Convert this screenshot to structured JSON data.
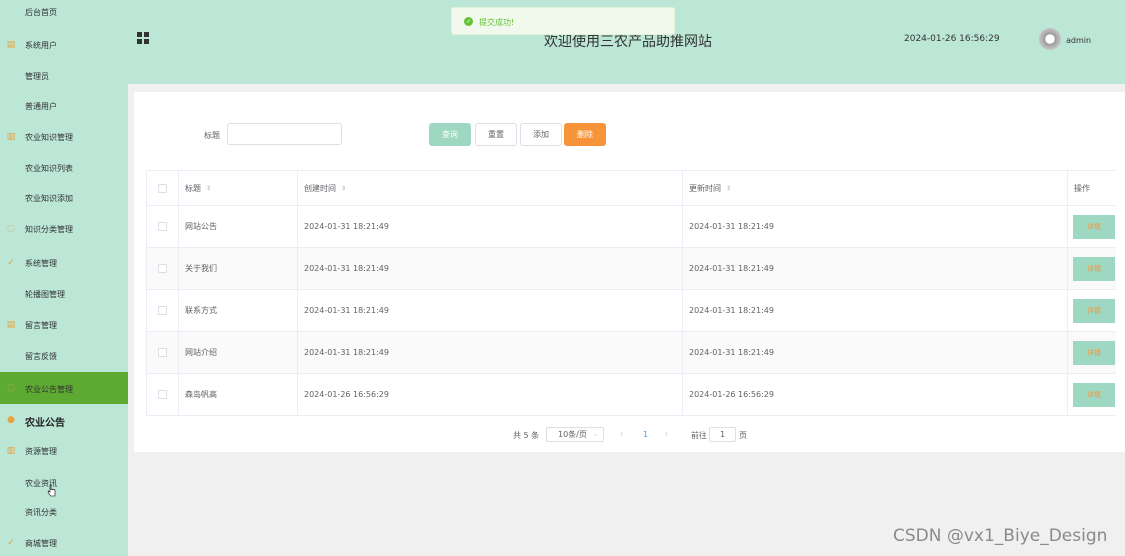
{
  "sidebar": {
    "items": [
      {
        "label": "后台首页",
        "icon": "none"
      },
      {
        "label": "系统用户",
        "icon": "document-icon"
      },
      {
        "label": "管理员",
        "icon": "none"
      },
      {
        "label": "普通用户",
        "icon": "none"
      },
      {
        "label": "农业知识管理",
        "icon": "bar-chart-icon"
      },
      {
        "label": "农业知识列表",
        "icon": "none"
      },
      {
        "label": "农业知识添加",
        "icon": "none"
      },
      {
        "label": "知识分类管理",
        "icon": "chat-icon"
      },
      {
        "label": "系统管理",
        "icon": "check-circle-icon"
      },
      {
        "label": "轮播图管理",
        "icon": "none"
      },
      {
        "label": "留言管理",
        "icon": "document-icon"
      },
      {
        "label": "留言反馈",
        "icon": "none"
      },
      {
        "label": "农业公告管理",
        "icon": "chat-icon",
        "active": true
      },
      {
        "label": "农业公告",
        "icon": "location-icon"
      },
      {
        "label": "资源管理",
        "icon": "bar-chart-icon"
      },
      {
        "label": "农业资讯",
        "icon": "none"
      },
      {
        "label": "资讯分类",
        "icon": "none"
      },
      {
        "label": "商城管理",
        "icon": "check-circle-icon"
      }
    ]
  },
  "header": {
    "title": "欢迎使用三农产品助推网站",
    "datetime": "2024-01-26 16:56:29",
    "username": "admin"
  },
  "toast": {
    "message": "提交成功!"
  },
  "search": {
    "label": "标题",
    "value": ""
  },
  "buttons": {
    "query": "查询",
    "reset": "重置",
    "add": "添加",
    "delete": "删除"
  },
  "table": {
    "headers": {
      "title": "标题",
      "created": "创建时间",
      "updated": "更新时间",
      "actions": "操作"
    },
    "rows": [
      {
        "title": "网站公告",
        "created": "2024-01-31 18:21:49",
        "updated": "2024-01-31 18:21:49",
        "action": "详情"
      },
      {
        "title": "关于我们",
        "created": "2024-01-31 18:21:49",
        "updated": "2024-01-31 18:21:49",
        "action": "详情"
      },
      {
        "title": "联系方式",
        "created": "2024-01-31 18:21:49",
        "updated": "2024-01-31 18:21:49",
        "action": "详情"
      },
      {
        "title": "网站介绍",
        "created": "2024-01-31 18:21:49",
        "updated": "2024-01-31 18:21:49",
        "action": "详情"
      },
      {
        "title": "森岛帆高",
        "created": "2024-01-26 16:56:29",
        "updated": "2024-01-26 16:56:29",
        "action": "详情"
      }
    ]
  },
  "pagination": {
    "total": "共 5 条",
    "page_size": "10条/页",
    "current_page": "1",
    "goto_label": "前往",
    "goto_value": "1",
    "page_suffix": "页"
  },
  "watermark": "CSDN @vx1_Biye_Design",
  "colors": {
    "sidebar_bg": "#bce6d6",
    "active_item": "#5daa32",
    "primary_btn": "#9ed8c2",
    "danger_btn": "#f7943a",
    "success": "#67c23a"
  }
}
